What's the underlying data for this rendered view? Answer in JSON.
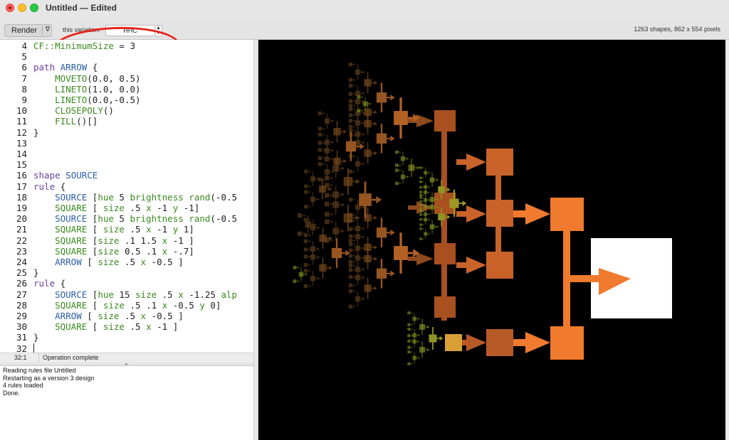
{
  "window": {
    "title": "Untitled — Edited"
  },
  "toolbar": {
    "render_label": "Render",
    "render_menu_glyph": "∇",
    "variation_label": "this variation:",
    "variation_value": "HHC",
    "shape_info": "1263 shapes, 862 x 554 pixels"
  },
  "editor": {
    "lines": [
      {
        "n": "4",
        "text": "CF::MinimumSize = 3"
      },
      {
        "n": "5",
        "text": ""
      },
      {
        "n": "6",
        "text": "path ARROW {"
      },
      {
        "n": "7",
        "text": "    MOVETO(0.0, 0.5)"
      },
      {
        "n": "8",
        "text": "    LINETO(1.0, 0.0)"
      },
      {
        "n": "9",
        "text": "    LINETO(0.0,-0.5)"
      },
      {
        "n": "10",
        "text": "    CLOSEPOLY()"
      },
      {
        "n": "11",
        "text": "    FILL()[]"
      },
      {
        "n": "12",
        "text": "}"
      },
      {
        "n": "13",
        "text": ""
      },
      {
        "n": "14",
        "text": ""
      },
      {
        "n": "15",
        "text": ""
      },
      {
        "n": "16",
        "text": "shape SOURCE"
      },
      {
        "n": "17",
        "text": "rule {"
      },
      {
        "n": "18",
        "text": "    SOURCE [hue 5 brightness rand(-0.5"
      },
      {
        "n": "19",
        "text": "    SQUARE [ size .5 x -1 y -1]"
      },
      {
        "n": "20",
        "text": "    SOURCE [hue 5 brightness rand(-0.5"
      },
      {
        "n": "21",
        "text": "    SQUARE [ size .5 x -1 y 1]"
      },
      {
        "n": "22",
        "text": "    SQUARE [size .1 1.5 x -1 ]"
      },
      {
        "n": "23",
        "text": "    SQUARE [size 0.5 .1 x -.7]"
      },
      {
        "n": "24",
        "text": "    ARROW [ size .5 x -0.5 ]"
      },
      {
        "n": "25",
        "text": "}"
      },
      {
        "n": "26",
        "text": "rule {"
      },
      {
        "n": "27",
        "text": "    SOURCE [hue 15 size .5 x -1.25 alp"
      },
      {
        "n": "28",
        "text": "    SQUARE [ size .5 .1 x -0.5 y 0]"
      },
      {
        "n": "29",
        "text": "    ARROW [ size .5 x -0.5 ]"
      },
      {
        "n": "30",
        "text": "    SQUARE [ size .5 x -1 ]"
      },
      {
        "n": "31",
        "text": "}"
      },
      {
        "n": "32",
        "text": ""
      }
    ]
  },
  "status": {
    "position": "32:1",
    "message": "Operation complete"
  },
  "log": {
    "lines": [
      "Reading rules file Untitled",
      "Restarting as a version 3 design",
      "4 rules loaded",
      "Done."
    ]
  },
  "colors": {
    "keyword": "#6b3fa0",
    "function": "#3a8a1e",
    "shape": "#2a5ea8",
    "accent_orange": "#f07a2d",
    "annotation_red": "#e8231a"
  }
}
